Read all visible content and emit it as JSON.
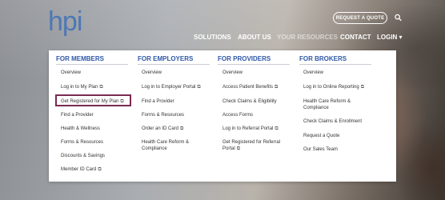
{
  "header": {
    "logo": "hpi",
    "quote_button": "REQUEST A QUOTE",
    "search_icon": "search-icon"
  },
  "nav": {
    "solutions": "SOLUTIONS",
    "about": "ABOUT US",
    "resources": "YOUR RESOURCES",
    "contact": "CONTACT",
    "login": "LOGIN ▾"
  },
  "menu": {
    "columns": [
      {
        "title": "FOR MEMBERS",
        "links": [
          {
            "label": "Overview",
            "ext": ""
          },
          {
            "label": "Log in to My Plan",
            "ext": "⧉"
          },
          {
            "label": "Get Registered for My Plan",
            "ext": "⧉"
          },
          {
            "label": "Find a Provider",
            "ext": ""
          },
          {
            "label": "Health & Wellness",
            "ext": ""
          },
          {
            "label": "Forms & Resources",
            "ext": ""
          },
          {
            "label": "Discounts & Savings",
            "ext": ""
          },
          {
            "label": "Member ID Card",
            "ext": "⧉"
          }
        ]
      },
      {
        "title": "FOR EMPLOYERS",
        "links": [
          {
            "label": "Overview",
            "ext": ""
          },
          {
            "label": "Log in to Employer Portal",
            "ext": "⧉"
          },
          {
            "label": "Find a Provider",
            "ext": ""
          },
          {
            "label": "Forms & Resources",
            "ext": ""
          },
          {
            "label": "Order an ID Card",
            "ext": "⧉"
          },
          {
            "label": "Health Care Reform &",
            "ext": ""
          },
          {
            "label": "Compliance",
            "ext": ""
          }
        ]
      },
      {
        "title": "FOR PROVIDERS",
        "links": [
          {
            "label": "Overview",
            "ext": ""
          },
          {
            "label": "Access Patient Benefits",
            "ext": "⧉"
          },
          {
            "label": "Check Claims & Eligibility",
            "ext": ""
          },
          {
            "label": "Access Forms",
            "ext": ""
          },
          {
            "label": "Log in to Referral Portal",
            "ext": "⧉"
          },
          {
            "label": "Get Registered for Referral",
            "ext": ""
          },
          {
            "label": "Portal",
            "ext": "⧉"
          }
        ]
      },
      {
        "title": "FOR BROKERS",
        "links": [
          {
            "label": "Overview",
            "ext": ""
          },
          {
            "label": "Log in to Online Reporting",
            "ext": "⧉"
          },
          {
            "label": "Health Care Reform &",
            "ext": ""
          },
          {
            "label": "Compliance",
            "ext": ""
          },
          {
            "label": "Check Claims & Enrollment",
            "ext": ""
          },
          {
            "label": "Request a Quote",
            "ext": ""
          },
          {
            "label": "Our Sales Team",
            "ext": ""
          }
        ]
      }
    ]
  }
}
